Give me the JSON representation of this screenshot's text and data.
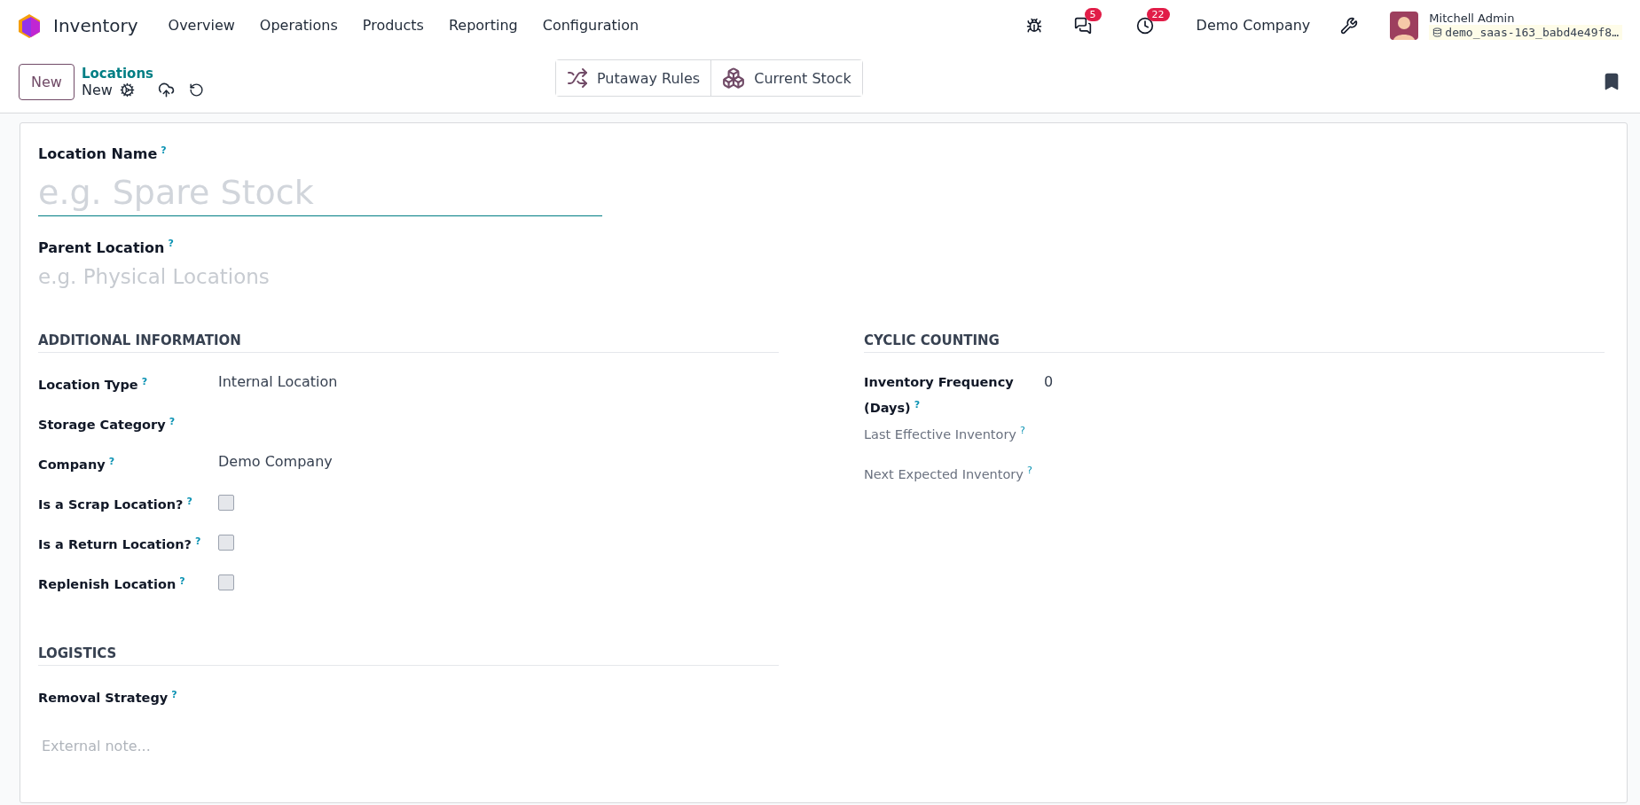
{
  "navbar": {
    "app": "Inventory",
    "menu": [
      "Overview",
      "Operations",
      "Products",
      "Reporting",
      "Configuration"
    ],
    "messages_count": "5",
    "activities_count": "22",
    "company": "Demo Company",
    "user": "Mitchell Admin",
    "database": "demo_saas-163_babd4e49f8…"
  },
  "control_panel": {
    "new_button": "New",
    "breadcrumb": "Locations",
    "record": "New",
    "smart_buttons": [
      {
        "kind": "shuffle",
        "label": "Putaway Rules"
      },
      {
        "kind": "cubes",
        "label": "Current Stock"
      }
    ]
  },
  "form": {
    "name_field": {
      "label": "Location Name",
      "help": "?",
      "placeholder": "e.g. Spare Stock"
    },
    "parent_field": {
      "label": "Parent Location",
      "help": "?",
      "placeholder": "e.g. Physical Locations"
    },
    "sections": [
      {
        "title": "ADDITIONAL INFORMATION",
        "fields": [
          {
            "kind": "text",
            "label": "Location Type",
            "help": "?",
            "value": "Internal Location",
            "muted": false
          },
          {
            "kind": "text",
            "label": "Storage Category",
            "help": "?",
            "muted": false
          },
          {
            "kind": "text",
            "label": "Company",
            "help": "?",
            "value": "Demo Company",
            "muted": false
          },
          {
            "kind": "checkbox",
            "label": "Is a Scrap Location?",
            "help": "?",
            "checked": false,
            "muted": false
          },
          {
            "kind": "checkbox",
            "label": "Is a Return Location?",
            "help": "?",
            "checked": false,
            "muted": false
          },
          {
            "kind": "checkbox",
            "label": "Replenish Location",
            "help": "?",
            "checked": false,
            "muted": false
          }
        ]
      },
      {
        "title": "CYCLIC COUNTING",
        "fields": [
          {
            "kind": "text",
            "label": "Inventory Frequency (Days)",
            "help": "?",
            "value": "0",
            "muted": false
          },
          {
            "kind": "text",
            "label": "Last Effective Inventory",
            "help": "?",
            "muted": true
          },
          {
            "kind": "text",
            "label": "Next Expected Inventory",
            "help": "?",
            "muted": true
          }
        ]
      },
      {
        "title": "LOGISTICS",
        "fields": [
          {
            "kind": "text",
            "label": "Removal Strategy",
            "help": "?",
            "muted": false
          }
        ]
      }
    ],
    "note_placeholder": "External note..."
  }
}
